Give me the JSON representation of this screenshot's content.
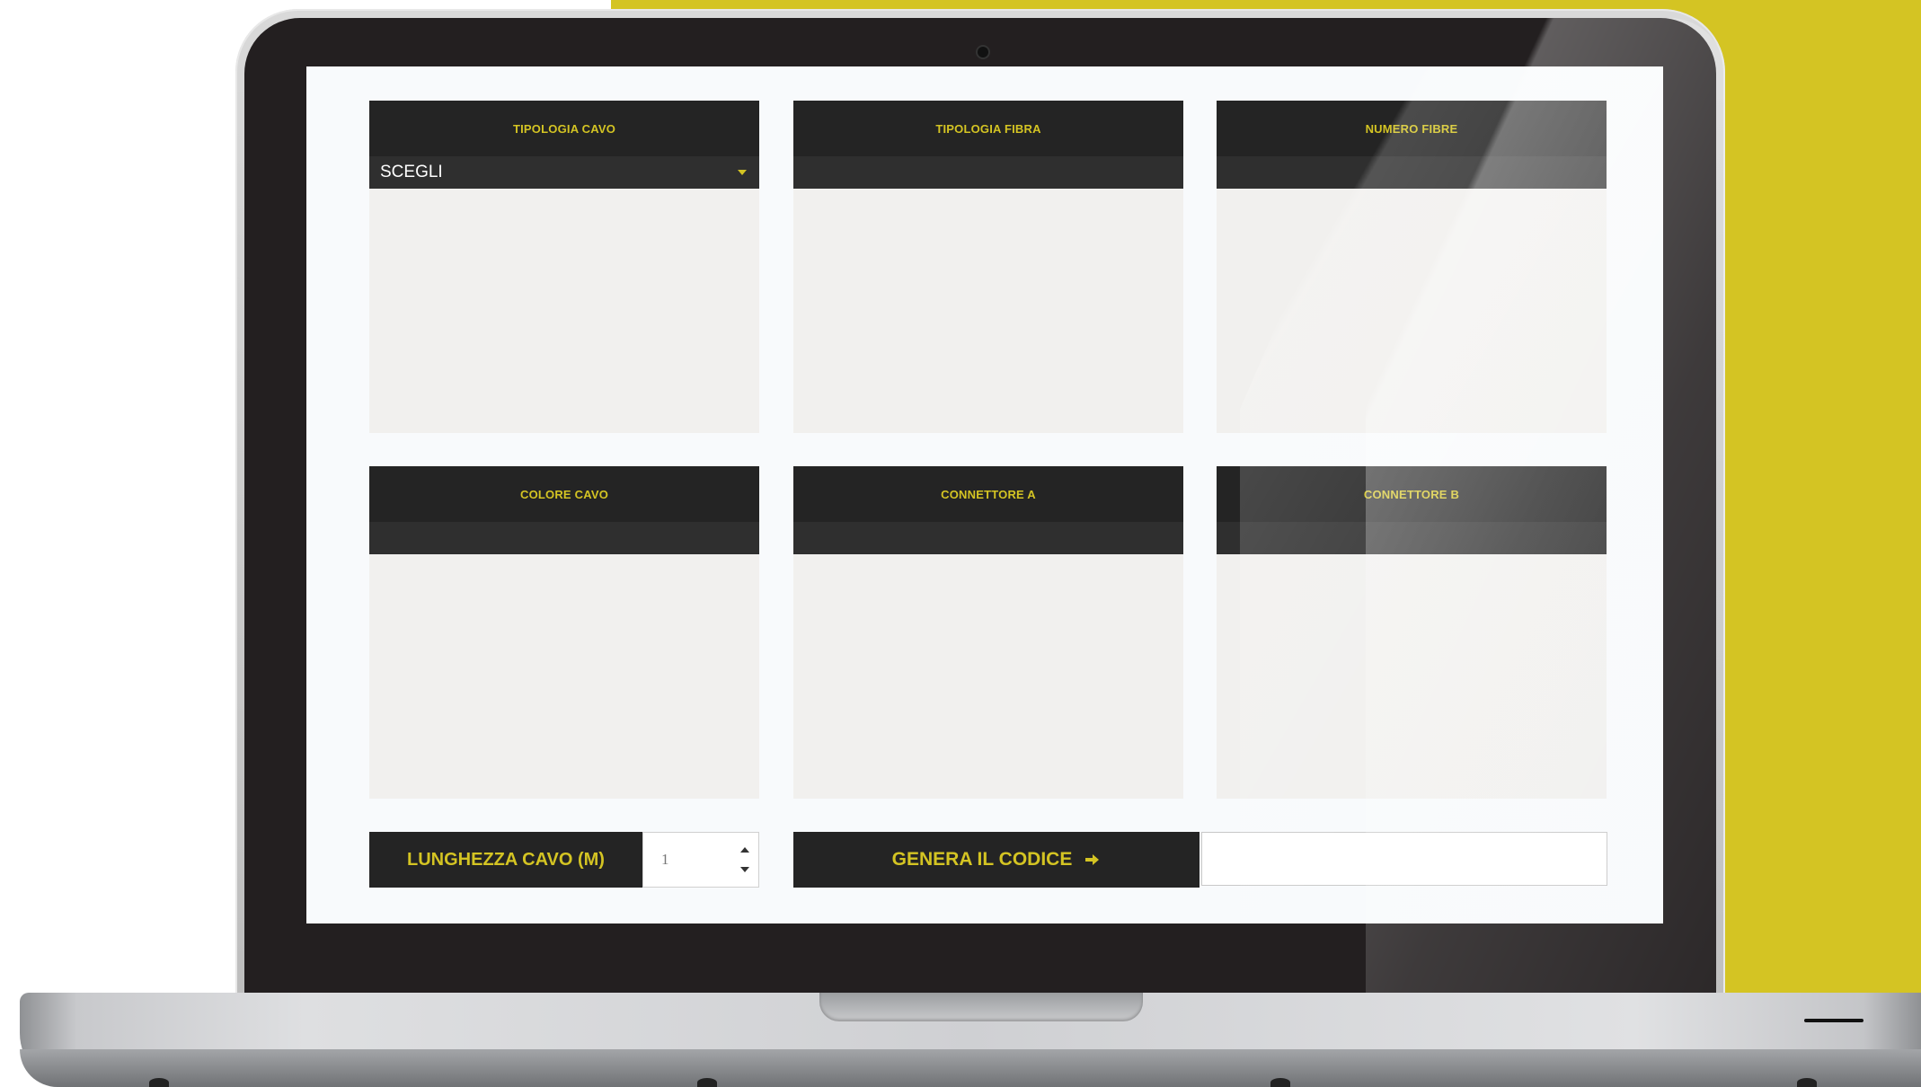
{
  "panels": [
    {
      "title": "TIPOLOGIA CAVO",
      "select_value": "SCEGLI"
    },
    {
      "title": "TIPOLOGIA FIBRA",
      "select_value": ""
    },
    {
      "title": "NUMERO FIBRE",
      "select_value": ""
    },
    {
      "title": "COLORE CAVO",
      "select_value": ""
    },
    {
      "title": "CONNETTORE A",
      "select_value": ""
    },
    {
      "title": "CONNETTORE B",
      "select_value": ""
    }
  ],
  "length": {
    "label": "LUNGHEZZA CAVO (M)",
    "value": "1"
  },
  "generate": {
    "label": "GENERA IL CODICE",
    "output": ""
  },
  "colors": {
    "accent": "#d4c423",
    "panel_header": "#242424",
    "panel_select": "#2f2f2f",
    "panel_body": "#f1f0ee"
  },
  "icons": {
    "select_caret": "caret-down-icon",
    "generate_arrow": "arrow-right-icon",
    "stepper": "number-stepper-icon"
  }
}
